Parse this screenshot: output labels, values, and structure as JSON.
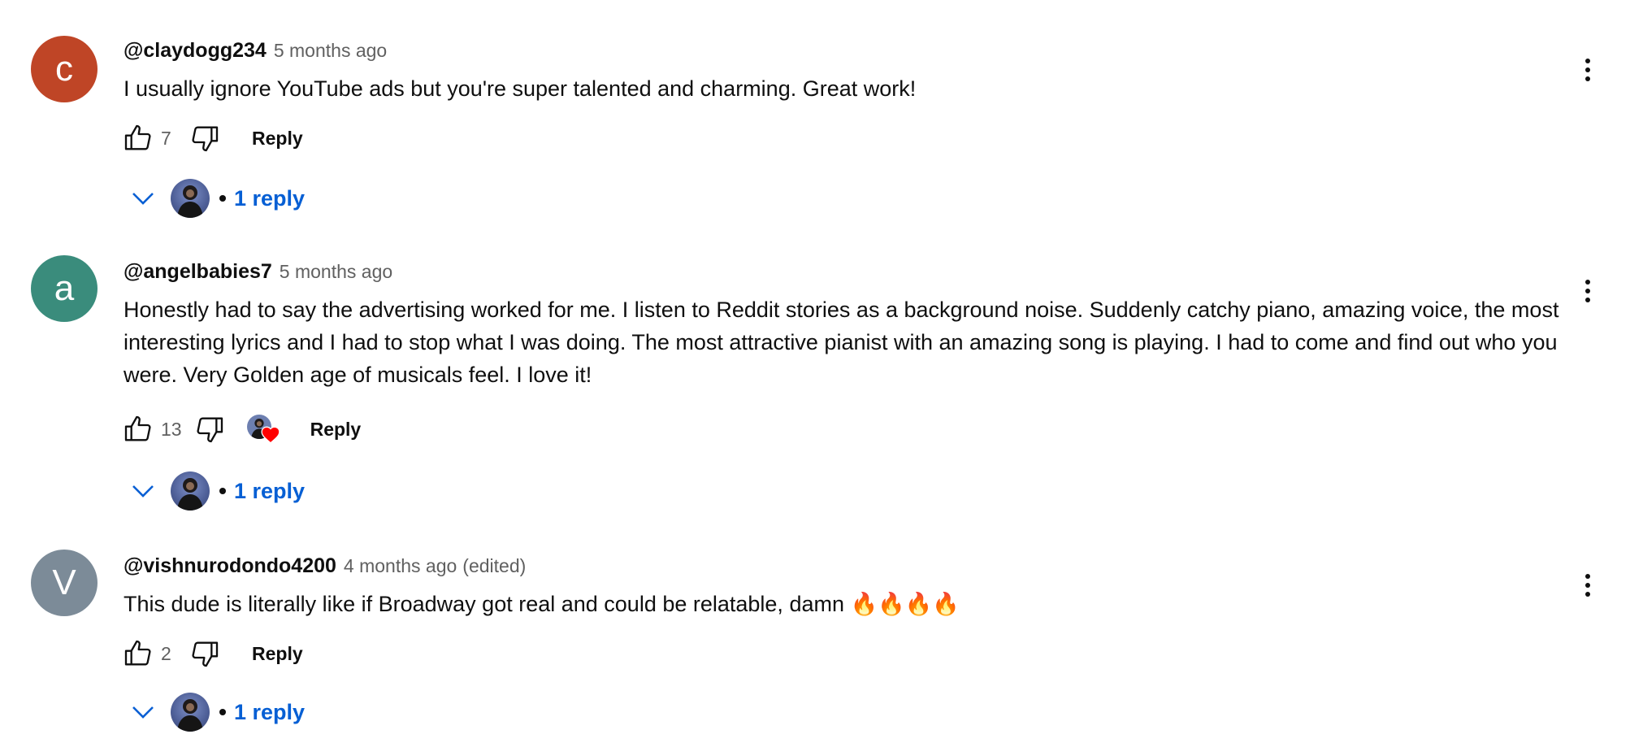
{
  "colors": {
    "link_blue": "#065fd4",
    "secondary_text": "#606060",
    "primary_text": "#0f0f0f",
    "heart_red": "#ff0000"
  },
  "icons": {
    "like": "thumb-up-icon",
    "dislike": "thumb-down-icon",
    "menu": "more-vert-icon",
    "expand": "chevron-down-icon",
    "creator_heart": "heart-icon"
  },
  "comments": [
    {
      "avatar_letter": "c",
      "avatar_color": "#bf4526",
      "author": "@claydogg234",
      "time": "5 months ago",
      "edited": "",
      "text": "I usually ignore YouTube ads but you're super talented and charming. Great work!",
      "likes": "7",
      "reply_label": "Reply",
      "replies_label": "1 reply",
      "creator_hearted": false
    },
    {
      "avatar_letter": "a",
      "avatar_color": "#3a8c7c",
      "author": "@angelbabies7",
      "time": "5 months ago",
      "edited": "",
      "text": "Honestly had to say the advertising worked for me. I listen to Reddit stories as a background noise. Suddenly catchy piano, amazing voice, the most interesting lyrics and I had to stop what I was doing. The most attractive pianist with an amazing song is playing. I had to come and find out who you were. Very Golden age of musicals feel. I love it!",
      "likes": "13",
      "reply_label": "Reply",
      "replies_label": "1 reply",
      "creator_hearted": true
    },
    {
      "avatar_letter": "V",
      "avatar_color": "#7c8b98",
      "author": "@vishnurodondo4200",
      "time": "4 months ago",
      "edited": "(edited)",
      "text": "This dude is literally like if Broadway got real and could be relatable, damn 🔥🔥🔥🔥",
      "likes": "2",
      "reply_label": "Reply",
      "replies_label": "1 reply",
      "creator_hearted": false
    }
  ]
}
